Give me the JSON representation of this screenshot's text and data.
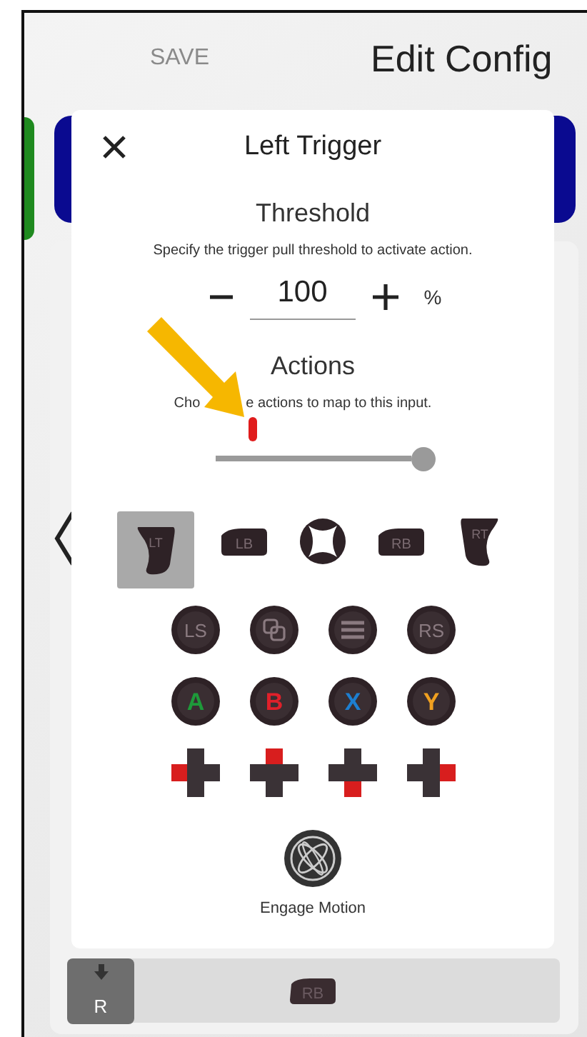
{
  "header": {
    "save": "SAVE",
    "title": "Edit Config"
  },
  "dialog": {
    "title": "Left Trigger",
    "threshold": {
      "title": "Threshold",
      "description": "Specify the trigger pull threshold to activate action.",
      "value": "100",
      "unit": "%"
    },
    "actions": {
      "title": "Actions",
      "description_parts": [
        "Cho",
        "e actions to map to this input."
      ]
    },
    "slider": {
      "level": 1.0
    },
    "live_input": {
      "level": 0.19
    },
    "button_rows": [
      [
        {
          "kind": "trigger",
          "label": "LT",
          "selected": true
        },
        {
          "kind": "bumper",
          "label": "LB",
          "selected": false
        },
        {
          "kind": "guide",
          "selected": false
        },
        {
          "kind": "bumper",
          "label": "RB",
          "selected": false
        },
        {
          "kind": "trigger",
          "label": "RT",
          "selected": false
        }
      ],
      [
        {
          "kind": "stick",
          "label": "LS",
          "selected": false
        },
        {
          "kind": "view",
          "selected": false
        },
        {
          "kind": "menu",
          "selected": false
        },
        {
          "kind": "stick",
          "label": "RS",
          "selected": false
        }
      ],
      [
        {
          "kind": "face",
          "label": "A",
          "color": "#1e9a3a",
          "selected": false
        },
        {
          "kind": "face",
          "label": "B",
          "color": "#e0202a",
          "selected": false
        },
        {
          "kind": "face",
          "label": "X",
          "color": "#1d7fd0",
          "selected": false
        },
        {
          "kind": "face",
          "label": "Y",
          "color": "#f0a020",
          "selected": false
        }
      ],
      [
        {
          "kind": "dpad_left",
          "selected": false
        },
        {
          "kind": "dpad_up",
          "selected": false
        },
        {
          "kind": "dpad_down",
          "selected": false
        },
        {
          "kind": "dpad_right",
          "selected": false
        }
      ]
    ],
    "motion": {
      "label": "Engage Motion"
    }
  },
  "bottom_row": {
    "thumbnail_label": "R",
    "button": "RB"
  }
}
